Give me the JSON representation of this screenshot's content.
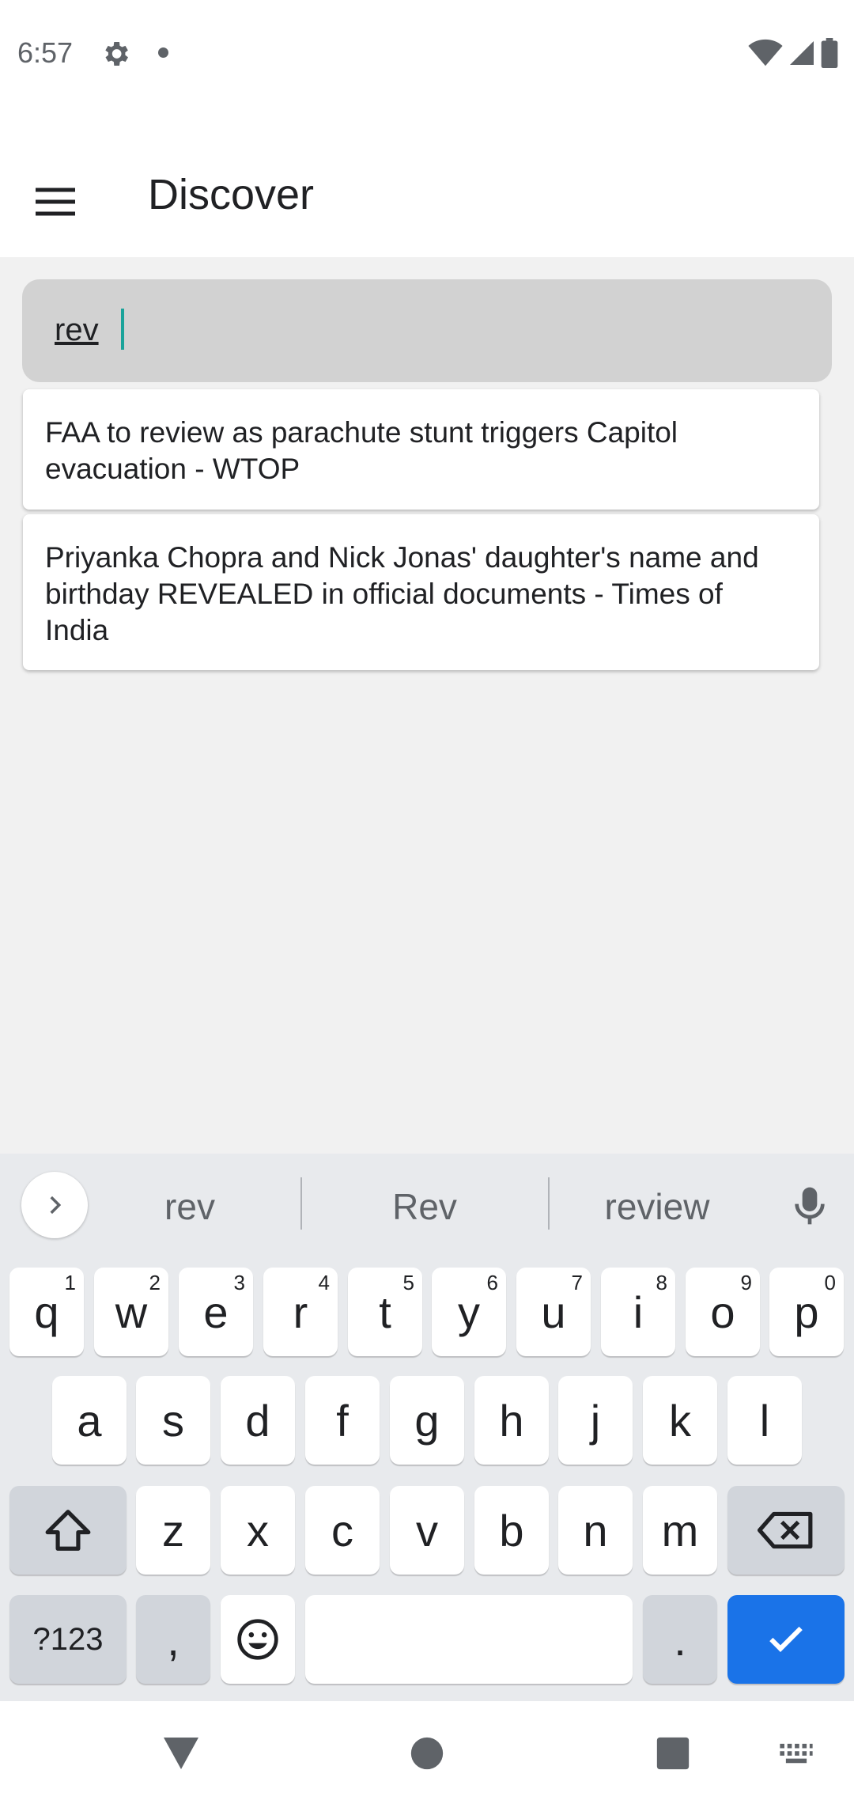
{
  "status_bar": {
    "time": "6:57",
    "icons": [
      "gear-icon",
      "dot-icon",
      "wifi-icon",
      "signal-icon",
      "battery-icon"
    ]
  },
  "app_bar": {
    "title": "Discover",
    "menu_icon": "hamburger-menu-icon"
  },
  "search": {
    "value": "rev"
  },
  "suggestions": [
    {
      "line1": "FAA to review as parachute stunt triggers Capitol",
      "line2": "evacuation - WTOP",
      "line3": ""
    },
    {
      "line1": "Priyanka Chopra and Nick Jonas' daughter's name and",
      "line2": "birthday REVEALED in official documents - Times of",
      "line3": "India"
    }
  ],
  "keyboard": {
    "suggestions": [
      "rev",
      "Rev",
      "review"
    ],
    "row1": [
      {
        "k": "q",
        "n": "1"
      },
      {
        "k": "w",
        "n": "2"
      },
      {
        "k": "e",
        "n": "3"
      },
      {
        "k": "r",
        "n": "4"
      },
      {
        "k": "t",
        "n": "5"
      },
      {
        "k": "y",
        "n": "6"
      },
      {
        "k": "u",
        "n": "7"
      },
      {
        "k": "i",
        "n": "8"
      },
      {
        "k": "o",
        "n": "9"
      },
      {
        "k": "p",
        "n": "0"
      }
    ],
    "row2": [
      "a",
      "s",
      "d",
      "f",
      "g",
      "h",
      "j",
      "k",
      "l"
    ],
    "row3": [
      "z",
      "x",
      "c",
      "v",
      "b",
      "n",
      "m"
    ],
    "symbols_label": "?123",
    "comma": ",",
    "period": ".",
    "accent_color": "#1a73e8"
  }
}
